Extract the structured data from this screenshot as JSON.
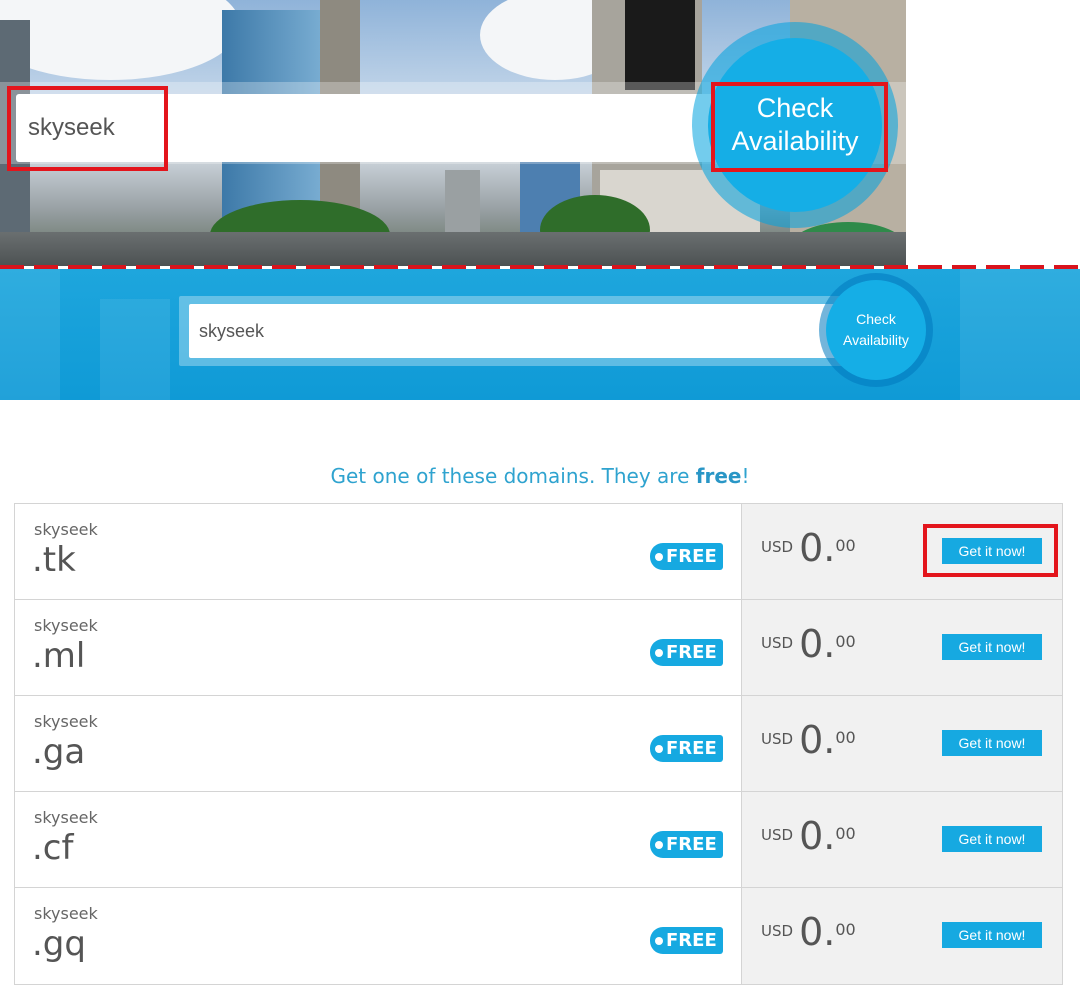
{
  "hero": {
    "search_value": "skyseek",
    "check_line1": "Check",
    "check_line2": "Availability"
  },
  "band": {
    "search_value": "skyseek",
    "check_line1": "Check",
    "check_line2": "Availability"
  },
  "heading": {
    "prefix": "Get one of these domains. They are ",
    "emphasis": "free",
    "suffix": "!"
  },
  "domains": [
    {
      "name": "skyseek",
      "tld": ".tk",
      "badge": "FREE",
      "currency": "USD",
      "price_int": "0.",
      "price_dec": "00",
      "button": "Get it now!"
    },
    {
      "name": "skyseek",
      "tld": ".ml",
      "badge": "FREE",
      "currency": "USD",
      "price_int": "0.",
      "price_dec": "00",
      "button": "Get it now!"
    },
    {
      "name": "skyseek",
      "tld": ".ga",
      "badge": "FREE",
      "currency": "USD",
      "price_int": "0.",
      "price_dec": "00",
      "button": "Get it now!"
    },
    {
      "name": "skyseek",
      "tld": ".cf",
      "badge": "FREE",
      "currency": "USD",
      "price_int": "0.",
      "price_dec": "00",
      "button": "Get it now!"
    },
    {
      "name": "skyseek",
      "tld": ".gq",
      "badge": "FREE",
      "currency": "USD",
      "price_int": "0.",
      "price_dec": "00",
      "button": "Get it now!"
    }
  ],
  "colors": {
    "accent": "#16a9e1",
    "highlight": "#e3151c",
    "heading": "#2fa3cf"
  }
}
